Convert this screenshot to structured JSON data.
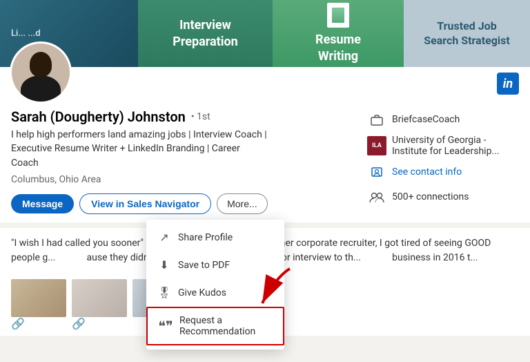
{
  "header": {
    "left_text": "Li... ...d",
    "interview_label": "Interview\nPreparation",
    "resume_label": "Resume\nWriting",
    "trusted_label": "Trusted Job\nSearch Strategist"
  },
  "profile": {
    "name": "Sarah (Dougherty) Johnston",
    "degree": "• 1st",
    "headline": "I help high performers land amazing jobs | Interview Coach |\nExecutive Resume Writer + LinkedIn Branding | Career\nCoach",
    "location": "Columbus, Ohio Area",
    "company": "BriefcaseCoach",
    "university": "University of Georgia -\nInstitute for Leadership...",
    "see_contact": "See contact info",
    "connections": "500+ connections"
  },
  "buttons": {
    "message": "Message",
    "sales_nav": "View in Sales Navigator",
    "more": "More..."
  },
  "dropdown": {
    "items": [
      {
        "id": "share",
        "label": "Share Profile",
        "icon": "↗"
      },
      {
        "id": "save-pdf",
        "label": "Save to PDF",
        "icon": "⬇"
      },
      {
        "id": "kudos",
        "label": "Give Kudos",
        "icon": "🎖"
      },
      {
        "id": "recommend",
        "label": "Request a Recommendation",
        "icon": "❝",
        "highlighted": true
      }
    ]
  },
  "summary": {
    "text": "\"I wish I had called you sooner\" is a common c... former corporate recruiter, I got tired of seeing GOOD people g... ause they didn't properly position themselves or interview to th... business in 2016 t..."
  },
  "linkedin_badge": "in"
}
